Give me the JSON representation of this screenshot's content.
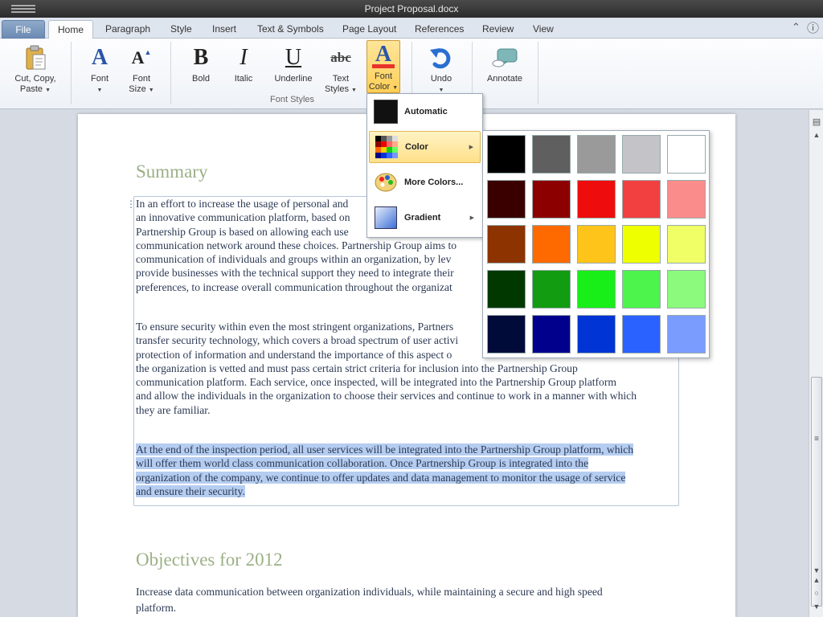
{
  "window": {
    "title": "Project Proposal.docx"
  },
  "tabs": [
    "File",
    "Home",
    "Paragraph",
    "Style",
    "Insert",
    "Text & Symbols",
    "Page Layout",
    "References",
    "Review",
    "View"
  ],
  "ribbon": {
    "clipboard": {
      "label_line1": "Cut, Copy,",
      "label_line2": "Paste"
    },
    "font": {
      "label": "Font"
    },
    "font_size": {
      "label_line1": "Font",
      "label_line2": "Size"
    },
    "bold": {
      "label": "Bold",
      "glyph": "B"
    },
    "italic": {
      "label": "Italic",
      "glyph": "I"
    },
    "underline": {
      "label": "Underline",
      "glyph": "U"
    },
    "text_styles": {
      "label_line1": "Text",
      "label_line2": "Styles",
      "glyph": "abc"
    },
    "font_color": {
      "label_line1": "Font",
      "label_line2": "Color",
      "glyph": "A"
    },
    "undo": {
      "label": "Undo"
    },
    "annotate": {
      "label": "Annotate"
    },
    "font_styles_group": "Font Styles",
    "font_glyph": "A"
  },
  "font_color_menu": {
    "items": [
      {
        "label": "Automatic"
      },
      {
        "label": "Color"
      },
      {
        "label": "More Colors..."
      },
      {
        "label": "Gradient"
      }
    ]
  },
  "palette": {
    "rows": [
      [
        "#000000",
        "#5f5f5f",
        "#9a9a9a",
        "#c3c3c8",
        "#ffffff"
      ],
      [
        "#3a0000",
        "#8c0000",
        "#ee0c0c",
        "#f24040",
        "#fa8c8c"
      ],
      [
        "#8c3300",
        "#ff6a00",
        "#ffc41a",
        "#eeff00",
        "#f0ff66"
      ],
      [
        "#003800",
        "#119c11",
        "#18ee18",
        "#4cf44c",
        "#8cfa7c"
      ],
      [
        "#000b3a",
        "#00008c",
        "#0034d4",
        "#2a62ff",
        "#7a9cff"
      ]
    ]
  },
  "document": {
    "summary_heading": "Summary",
    "p1": [
      "In an effort to increase the usage of personal and",
      "an innovative communication platform, based on",
      "Partnership Group is based on allowing each use",
      "communication network around these choices. Partnership Group aims to",
      "communication of individuals and groups within an organization, by lev",
      "provide businesses with the technical support they need to integrate their",
      "preferences, to increase overall communication throughout the organizat"
    ],
    "p2": [
      "To ensure security within even the most stringent organizations, Partners",
      "transfer security technology, which covers a broad spectrum of user activi",
      "protection of information and understand the importance of this aspect o",
      "the organization is vetted and must pass certain strict criteria for inclusion into the Partnership Group",
      "communication platform. Each service, once inspected, will be integrated into the Partnership Group platform",
      "and allow the individuals in the organization to choose their services and continue to work in a manner with which",
      "they are familiar."
    ],
    "p3": [
      "At the end of the inspection period, all user services will be integrated into the Partnership Group platform, which",
      "will offer them world class communication collaboration. Once Partnership Group is integrated into the",
      "organization of the company, we continue to offer updates and data management to monitor the usage of service",
      "and ensure their security."
    ],
    "objectives_heading": "Objectives for 2012",
    "p4": [
      "Increase data communication between organization individuals, while maintaining a secure and high speed",
      "platform."
    ]
  },
  "colors": {
    "heading": "#9bb086",
    "selection": "#b5cdf0",
    "accent": "#2a56a8"
  }
}
